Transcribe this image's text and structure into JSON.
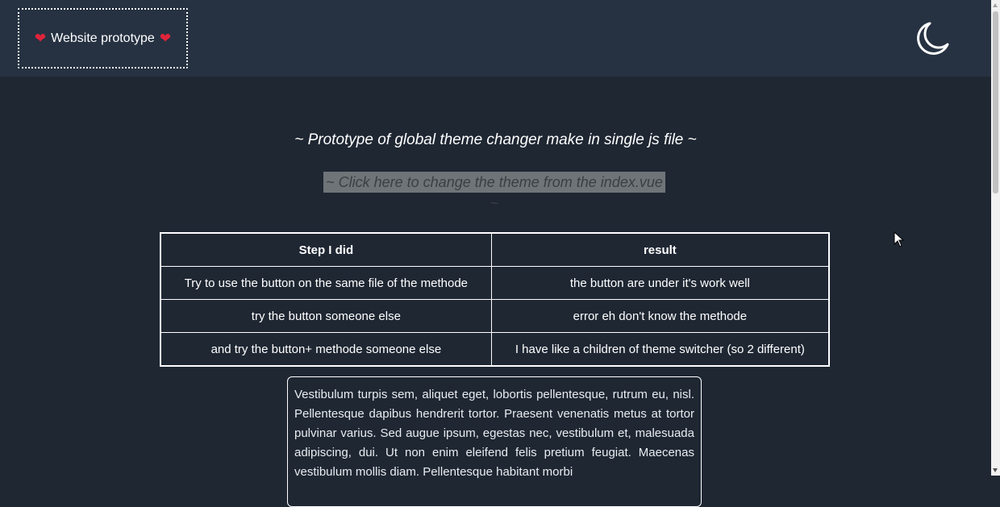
{
  "header": {
    "brand_text": "Website prototype",
    "heart_left": "❤",
    "heart_right": "❤",
    "theme_toggle_icon": "moon-icon"
  },
  "main": {
    "subtitle": "~ Prototype of global theme changer make in single js file ~",
    "change_theme_link": "~ Click here to change the theme from the index.vue ~"
  },
  "table": {
    "headers": [
      "Step I did",
      "result"
    ],
    "rows": [
      [
        "Try to use the button on the same file of the methode",
        "the button are under it's work well"
      ],
      [
        "try the button someone else",
        "error eh don't know the methode"
      ],
      [
        "and try the button+ methode someone else",
        "I have like a children of theme switcher (so 2 different)"
      ]
    ]
  },
  "textbox": {
    "text": "Vestibulum turpis sem, aliquet eget, lobortis pellentesque, rutrum eu, nisl. Pellentesque dapibus hendrerit tortor. Praesent venenatis metus at tortor pulvinar varius. Sed augue ipsum, egestas nec, vestibulum et, malesuada adipiscing, dui. Ut non enim eleifend felis pretium feugiat. Maecenas vestibulum mollis diam. Pellentesque habitant morbi"
  },
  "colors": {
    "background": "#1f2733",
    "header_background": "#263242",
    "heart": "#e0243a",
    "link_highlight": "#6f7478"
  }
}
